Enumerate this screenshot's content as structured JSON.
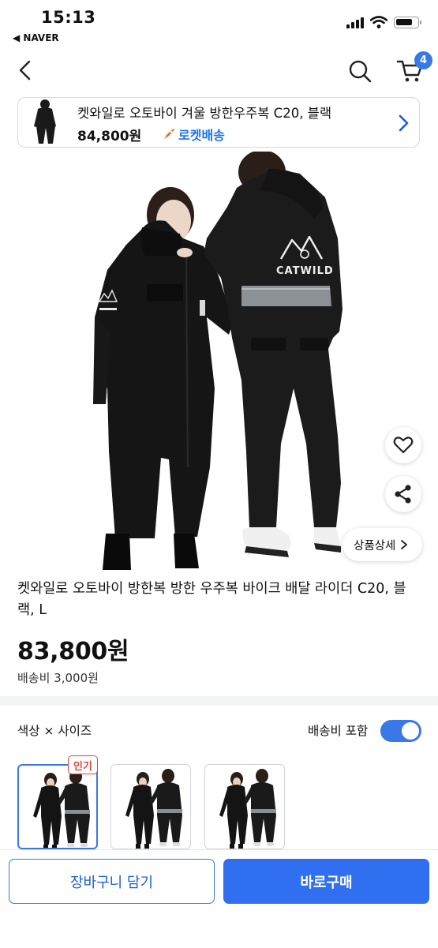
{
  "status_bar": {
    "time": "15:13",
    "back_app": "◀ NAVER"
  },
  "nav": {
    "cart_count": "4"
  },
  "sticky_card": {
    "title": "켓와일로 오토바이 겨울 방한우주복 C20, 블랙",
    "price": "84,800원",
    "delivery_badge": "로켓배송"
  },
  "hero": {
    "brand_text": "CATWILD",
    "detail_button": "상품상세"
  },
  "product": {
    "title": "켓와일로 오토바이 방한복 방한 우주복 바이크 배달 라이더 C20, 블랙, L",
    "price": "83,800원",
    "shipping_fee": "배송비 3,000원"
  },
  "options": {
    "label": "색상 × 사이즈",
    "toggle_label": "배송비 포함",
    "toggle_on": true,
    "popular_badge": "인기"
  },
  "bottom": {
    "add_to_cart": "장바구니 담기",
    "buy_now": "바로구매"
  },
  "colors": {
    "accent": "#2f6ff0",
    "badge_red": "#e0443a",
    "rocket_blue": "#1a73e8"
  }
}
